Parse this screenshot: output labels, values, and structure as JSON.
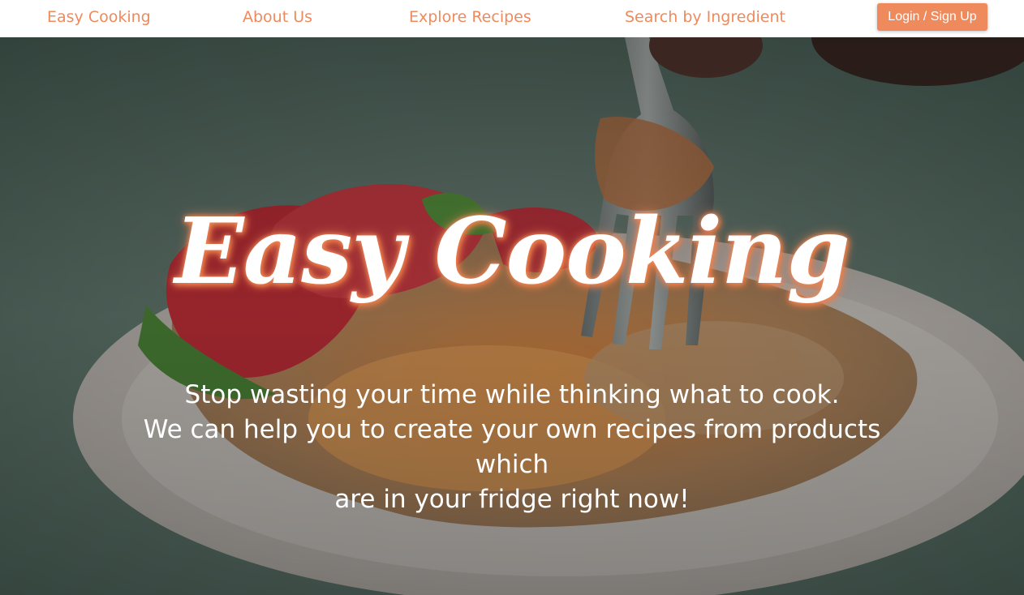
{
  "navbar": {
    "brand": "Easy Cooking",
    "links": [
      "About Us",
      "Explore Recipes",
      "Search by Ingredient"
    ],
    "login_label": "Login / Sign Up",
    "accent_color": "#ef8a5c"
  },
  "hero": {
    "title": "Easy Cooking",
    "lines": [
      "Stop wasting your time while thinking what to cook.",
      "We can help you to create your own recipes from products which",
      "are in your fridge right now!"
    ],
    "background_image": "plate of food with strawberries and a fork"
  }
}
